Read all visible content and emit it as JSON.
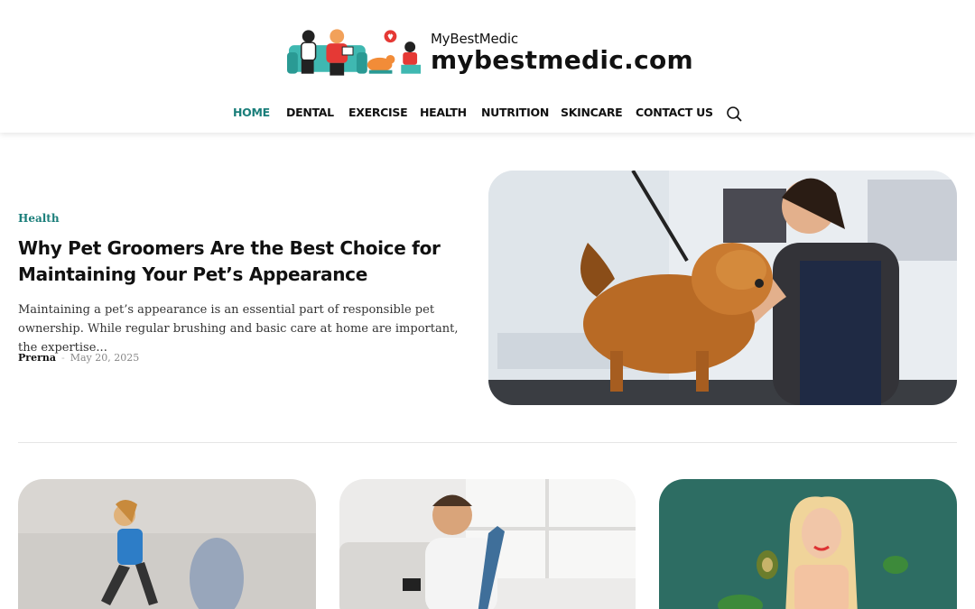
{
  "brand": {
    "small_name": "MyBestMedic",
    "domain": "mybestmedic.com",
    "accent_color": "#1a7e7a"
  },
  "nav": {
    "items": [
      {
        "label": "HOME",
        "active": true
      },
      {
        "label": "DENTAL"
      },
      {
        "label": "EXERCISE"
      },
      {
        "label": "HEALTH"
      },
      {
        "label": "NUTRITION"
      },
      {
        "label": "SKINCARE"
      },
      {
        "label": "CONTACT US"
      }
    ],
    "search_icon": "search-icon"
  },
  "featured": {
    "category": "Health",
    "title": "Why Pet Groomers Are the Best Choice for Maintaining Your Pet’s Appearance",
    "excerpt": "Maintaining a pet’s appearance is an essential part of responsible pet ownership. While regular brushing and basic care at home are important, the expertise...",
    "author": "Prerna",
    "separator": "-",
    "date": "May 20, 2025"
  }
}
